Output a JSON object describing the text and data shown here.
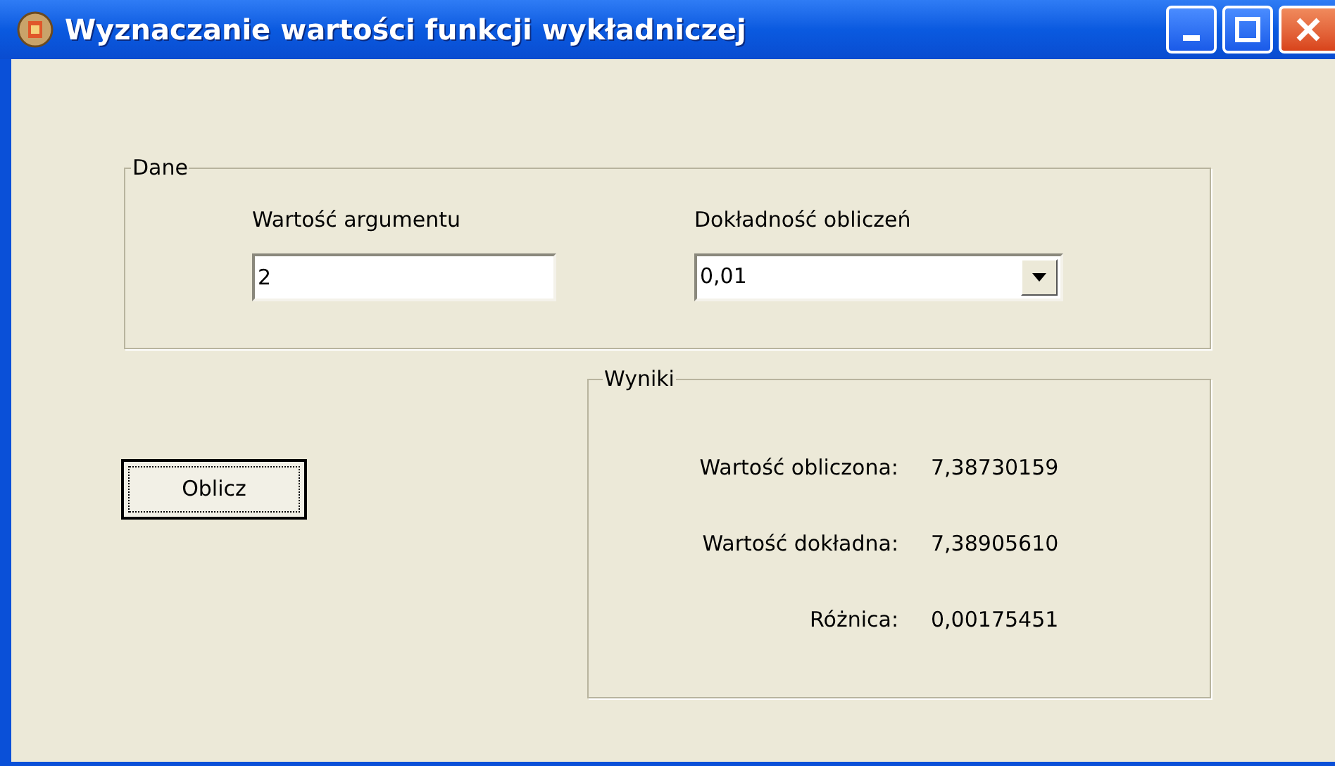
{
  "window": {
    "title": "Wyznaczanie wartości funkcji wykładniczej"
  },
  "input_group": {
    "title": "Dane",
    "argument": {
      "label": "Wartość argumentu",
      "value": "2"
    },
    "precision": {
      "label": "Dokładność obliczeń",
      "value": "0,01"
    }
  },
  "compute_button": {
    "label": "Oblicz",
    "focused": true
  },
  "results_group": {
    "title": "Wyniki",
    "rows": [
      {
        "label": "Wartość obliczona:",
        "value": "7,38730159"
      },
      {
        "label": "Wartość dokładna:",
        "value": "7,38905610"
      },
      {
        "label": "Różnica:",
        "value": "0,00175451"
      }
    ]
  }
}
